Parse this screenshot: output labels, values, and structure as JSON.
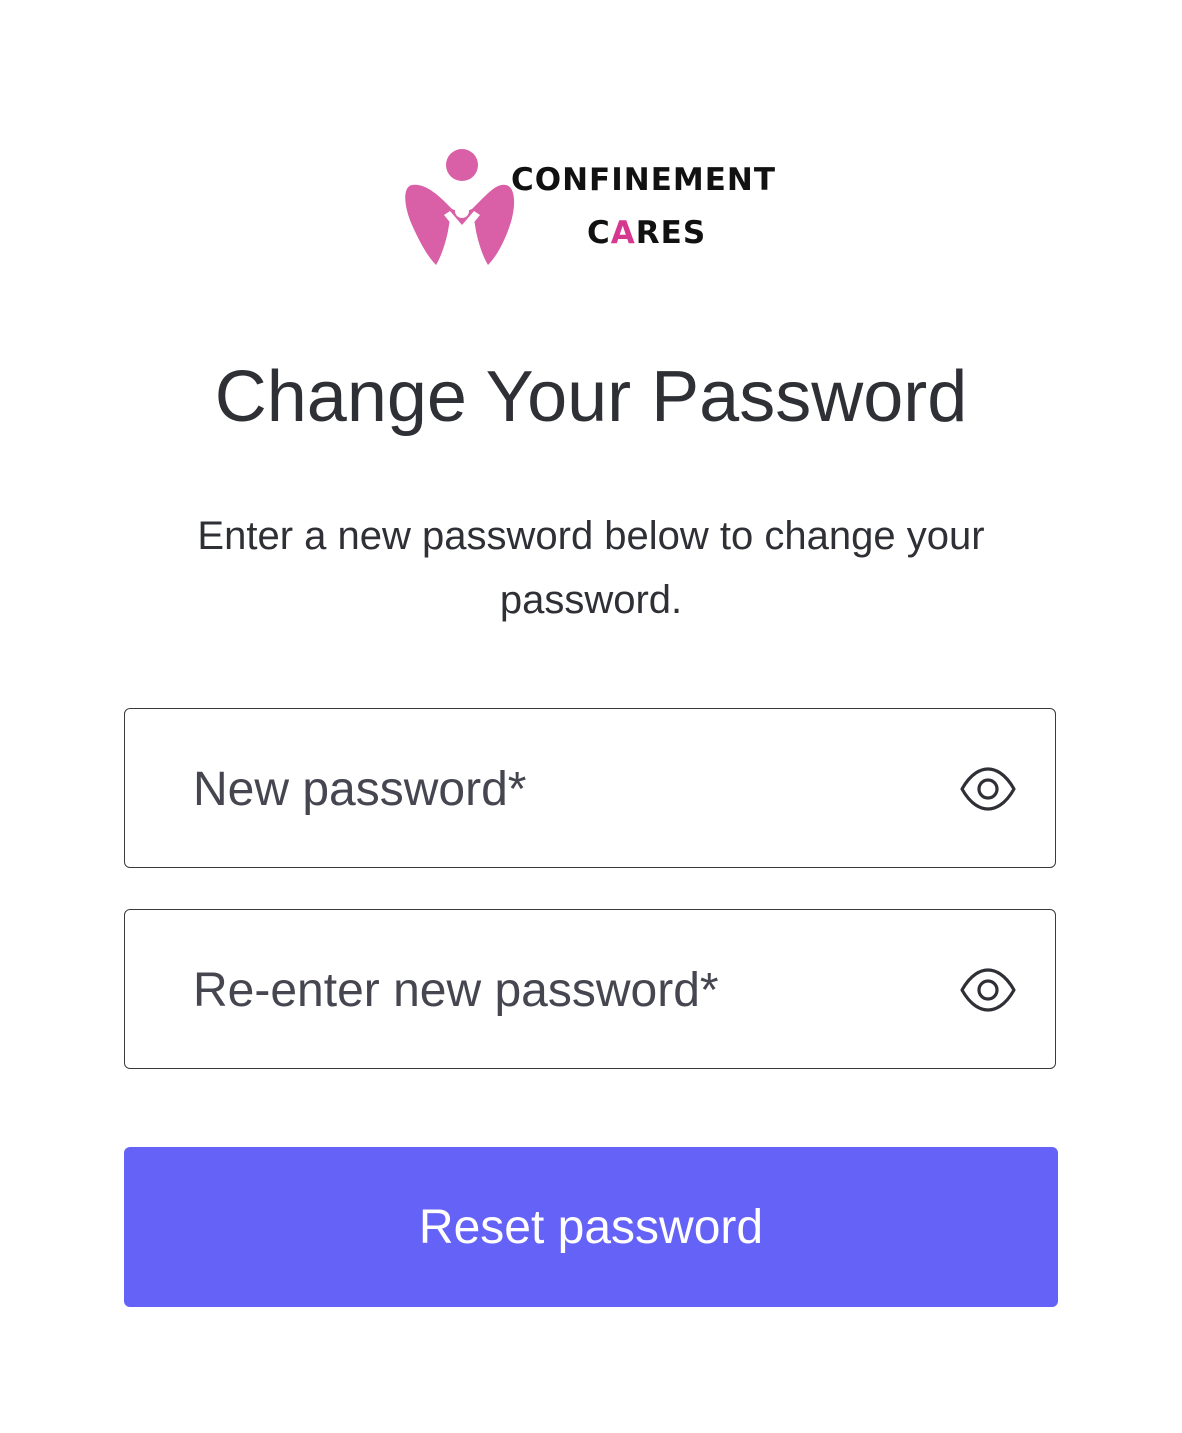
{
  "brand": {
    "name_line1": "CONFINEMENT",
    "name_line2_prefix": "C",
    "name_line2_accent": "A",
    "name_line2_suffix": "RES",
    "logo_color": "#d95fa6",
    "accent_color": "#d6378f"
  },
  "page": {
    "title": "Change Your Password",
    "subtitle": "Enter a new password below to change your password."
  },
  "form": {
    "new_password": {
      "placeholder": "New password*",
      "value": "",
      "toggle_icon": "eye-icon"
    },
    "confirm_password": {
      "placeholder": "Re-enter new password*",
      "value": "",
      "toggle_icon": "eye-icon"
    },
    "submit_label": "Reset password",
    "submit_color": "#6562f7"
  }
}
